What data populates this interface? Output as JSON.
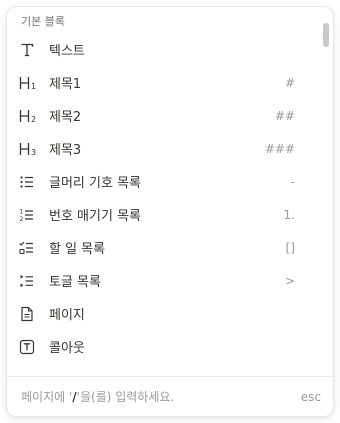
{
  "menu": {
    "section_label": "기본 블록",
    "items": [
      {
        "label": "텍스트",
        "shortcut": "",
        "icon": "text-icon"
      },
      {
        "label": "제목1",
        "shortcut": "#",
        "icon": "heading-1-icon"
      },
      {
        "label": "제목2",
        "shortcut": "##",
        "icon": "heading-2-icon"
      },
      {
        "label": "제목3",
        "shortcut": "###",
        "icon": "heading-3-icon"
      },
      {
        "label": "글머리 기호 목록",
        "shortcut": "-",
        "icon": "bulleted-list-icon"
      },
      {
        "label": "번호 매기기 목록",
        "shortcut": "1.",
        "icon": "numbered-list-icon"
      },
      {
        "label": "할 일 목록",
        "shortcut": "[]",
        "icon": "todo-list-icon"
      },
      {
        "label": "토글 목록",
        "shortcut": ">",
        "icon": "toggle-list-icon"
      },
      {
        "label": "페이지",
        "shortcut": "",
        "icon": "page-icon"
      },
      {
        "label": "콜아웃",
        "shortcut": "",
        "icon": "callout-icon"
      }
    ]
  },
  "footer": {
    "hint_prefix": "페이지에 '",
    "hint_slash": "/",
    "hint_suffix": "'을(를) 입력하세요.",
    "esc_label": "esc"
  }
}
